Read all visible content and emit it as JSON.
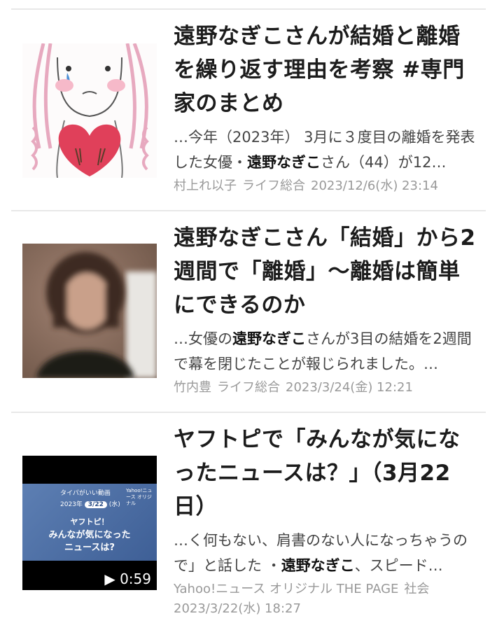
{
  "articles": [
    {
      "title": "遠野なぎこさんが結婚と離婚を繰り返す理由を考察 #専門家のまとめ",
      "snippet_pre": "…今年（2023年） 3月に３度目の離婚を発表した女優・",
      "snippet_bold": "遠野なぎこ",
      "snippet_post": "さん（44）が12…",
      "author": "村上れ以子",
      "category": "ライフ総合",
      "date": "2023/12/6(水) 23:14",
      "thumb_icon": "crying-girl-heart-illustration"
    },
    {
      "title": "遠野なぎこさん「結婚」から2週間で「離婚」〜離婚は簡単にできるのか",
      "snippet_pre": "…女優の",
      "snippet_bold": "遠野なぎこ",
      "snippet_post": "さんが3目の結婚を2週間で幕を閉じたことが報じられました。…",
      "author": "竹内豊",
      "category": "ライフ総合",
      "date": "2023/3/24(金) 12:21",
      "thumb_icon": "blurred-woman-photo"
    },
    {
      "title": "ヤフトピで「みんなが気になったニュースは？」（3月22日）",
      "snippet_pre": "…く何もない、肩書のない人になっちゃうので」と話した ・",
      "snippet_bold": "遠野なぎこ",
      "snippet_post": "、スピード…",
      "author": "Yahoo!ニュース オリジナル THE PAGE",
      "category": "社会",
      "date": "2023/3/22(水) 18:27",
      "thumb_icon": "video-thumbnail",
      "video": {
        "duration": "0:59",
        "play_icon": "play-icon",
        "line1": "タイパがいい動画",
        "date_label": "2023年",
        "date_badge": "3/22",
        "date_day": "(水)",
        "brand": "Yahoo!ニュース オリジナル",
        "headline1": "ヤフトピ！",
        "headline2": "みんなが気になった",
        "headline3": "ニュースは?"
      }
    }
  ]
}
